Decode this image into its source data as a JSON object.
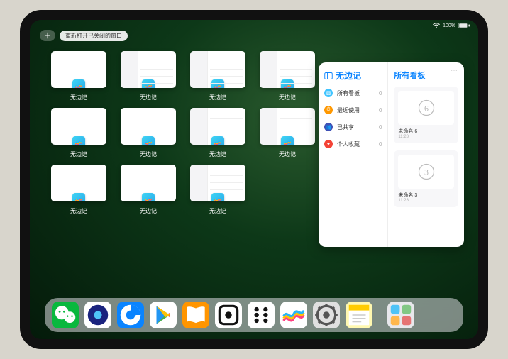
{
  "statusbar": {
    "battery": "100%"
  },
  "top": {
    "pill_label": "重新打开已关闭的窗口"
  },
  "app_label": "无边记",
  "app_count": 11,
  "detail_pattern": [
    1,
    2,
    3,
    6,
    7,
    10
  ],
  "panel": {
    "left": {
      "title": "无边记",
      "items": [
        {
          "icon": "layers",
          "color": "#40c4ff",
          "label": "所有看板",
          "count": 0
        },
        {
          "icon": "clock",
          "color": "#ff9800",
          "label": "最近使用",
          "count": 0
        },
        {
          "icon": "share",
          "color": "#3f51b5",
          "label": "已共享",
          "count": 0
        },
        {
          "icon": "heart",
          "color": "#f44336",
          "label": "个人收藏",
          "count": 0
        }
      ]
    },
    "right": {
      "title": "所有看板",
      "boards": [
        {
          "digit": "6",
          "label": "未命名 6",
          "time": "11:28"
        },
        {
          "digit": "3",
          "label": "未命名 3",
          "time": "11:28"
        }
      ]
    }
  },
  "dock": {
    "apps": [
      {
        "name": "wechat",
        "bg": "#09b83e"
      },
      {
        "name": "quark",
        "bg": "#ffffff"
      },
      {
        "name": "qqbrowser",
        "bg": "#0a84ff"
      },
      {
        "name": "googleplay",
        "bg": "#ffffff"
      },
      {
        "name": "books",
        "bg": "#ff9500"
      },
      {
        "name": "obsidian",
        "bg": "#ffffff"
      },
      {
        "name": "sixdots",
        "bg": "#ffffff"
      },
      {
        "name": "freeform",
        "bg": "#ffffff"
      },
      {
        "name": "settings",
        "bg": "#e0e0e0"
      },
      {
        "name": "notes",
        "bg": "#fff8b0"
      }
    ],
    "recent": {
      "name": "app-library",
      "bg": "#e8e8ec"
    }
  }
}
